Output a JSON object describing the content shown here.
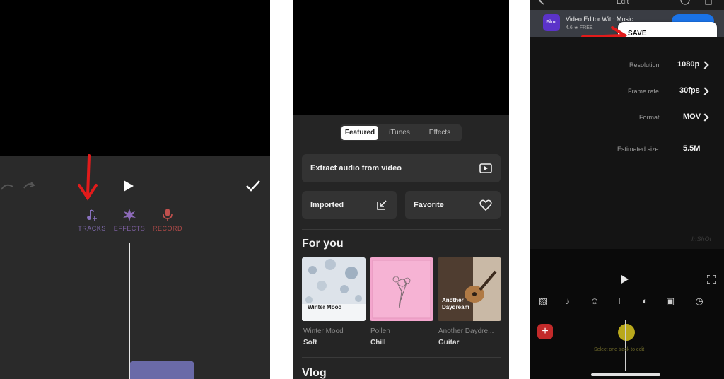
{
  "panel1": {
    "tools": [
      {
        "label": "TRACKS",
        "icon": "music-plus-icon",
        "color": "#7c68a8"
      },
      {
        "label": "EFFECTS",
        "icon": "burst-icon",
        "color": "#7b5e9e"
      },
      {
        "label": "RECORD",
        "icon": "mic-icon",
        "color": "#b04a48"
      }
    ]
  },
  "panel2": {
    "tabs": [
      "Featured",
      "iTunes",
      "Effects"
    ],
    "selected_tab": "Featured",
    "extract_label": "Extract audio from video",
    "imported_label": "Imported",
    "favorite_label": "Favorite",
    "for_you_heading": "For you",
    "albums": [
      {
        "cover_text": "Winter Mood",
        "title": "Winter Mood",
        "genre": "Soft"
      },
      {
        "cover_text": "",
        "title": "Pollen",
        "genre": "Chill"
      },
      {
        "cover_text": "Another Daydream",
        "title": "Another Daydre...",
        "genre": "Guitar"
      }
    ],
    "vlog_heading": "Vlog"
  },
  "panel3": {
    "title": "Edit",
    "ad": {
      "title": "Video Editor With Music",
      "rating": "4.6 ★ FREE"
    },
    "save_label": "SAVE",
    "settings": [
      {
        "label": "Resolution",
        "value": "1080p"
      },
      {
        "label": "Frame rate",
        "value": "30fps"
      },
      {
        "label": "Format",
        "value": "MOV"
      },
      {
        "label": "Estimated size",
        "value": "5.5M"
      }
    ],
    "watermark": "InShOt",
    "hint": "Select one track to edit"
  },
  "colors": {
    "annotation_arrow": "#e21b1b",
    "clip": "#6a6aa8",
    "record": "#b04a48"
  }
}
